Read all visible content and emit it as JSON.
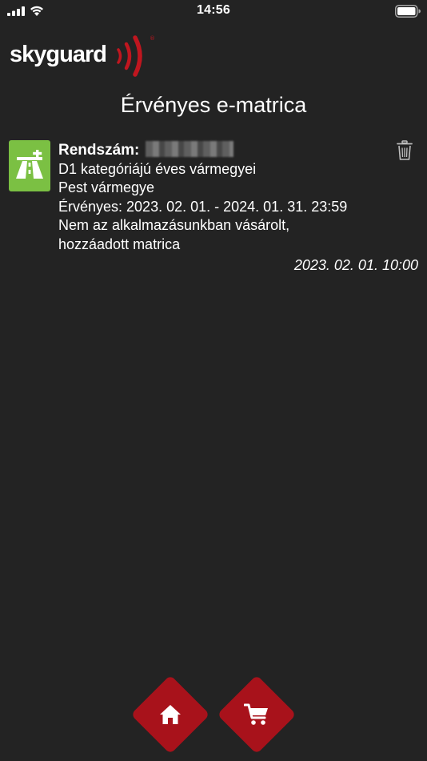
{
  "status_bar": {
    "time": "14:56"
  },
  "header": {
    "logo_text": "skyguard"
  },
  "page": {
    "title": "Érvényes e-matrica"
  },
  "sticker": {
    "plate_label": "Rendszám:",
    "plate_value": "",
    "category": "D1 kategóriájú éves vármegyei",
    "county": "Pest vármegye",
    "validity": "Érvényes: 2023. 02. 01. - 2024. 01. 31. 23:59",
    "note_line1": "Nem az alkalmazásunkban vásárolt,",
    "note_line2": "hozzáadott matrica",
    "purchase_datetime": "2023. 02. 01. 10:00",
    "icon": "highway-add-icon",
    "delete_icon": "trash-icon"
  },
  "nav": {
    "home_icon": "home-icon",
    "cart_icon": "cart-icon"
  },
  "colors": {
    "background": "#232323",
    "accent_red": "#a8121b",
    "sticker_green": "#7bc043"
  }
}
